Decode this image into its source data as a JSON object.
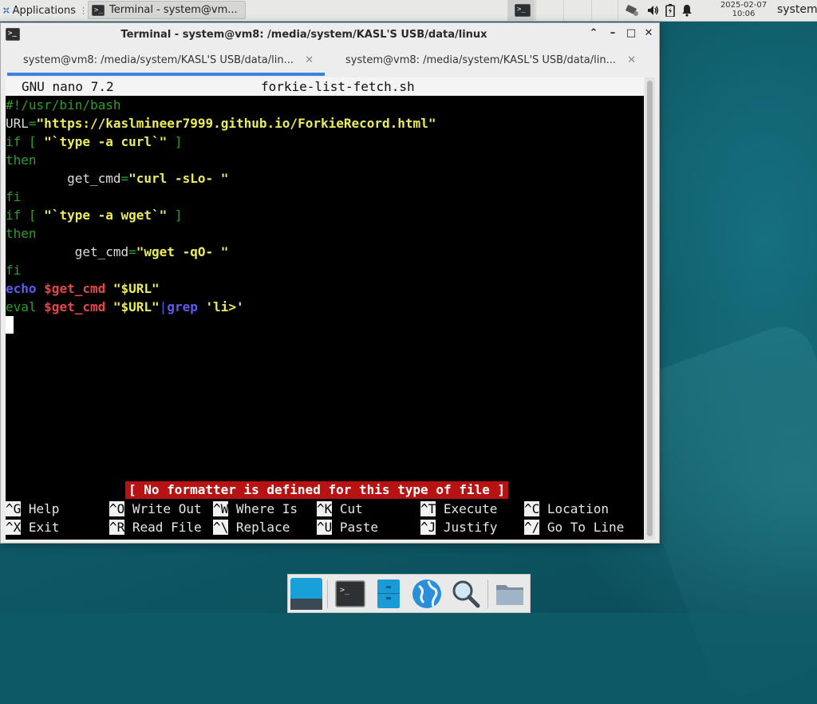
{
  "panel": {
    "apps_label": "Applications",
    "task_label": "Terminal - system@vm...",
    "clock_date": "2025-02-07",
    "clock_time": "10:06",
    "user": "system"
  },
  "window": {
    "title": "Terminal - system@vm8: /media/system/KASL'S USB/data/linux",
    "tabs": [
      {
        "label": "system@vm8: /media/system/KASL'S USB/data/lin...",
        "active": true
      },
      {
        "label": "system@vm8: /media/system/KASL'S USB/data/lin...",
        "active": false
      }
    ]
  },
  "nano": {
    "version": "GNU nano 7.2",
    "filename": "forkie-list-fetch.sh",
    "lines": [
      {
        "segments": [
          {
            "t": "#!/usr/bin/bash",
            "c": "green"
          }
        ]
      },
      {
        "segments": [
          {
            "t": "URL",
            "c": "white"
          },
          {
            "t": "=",
            "c": "green"
          },
          {
            "t": "\"https://kaslmineer7999.github.io/ForkieRecord.html\"",
            "c": "yellow"
          }
        ]
      },
      {
        "segments": [
          {
            "t": "if [ ",
            "c": "green"
          },
          {
            "t": "\"`type -a curl`\"",
            "c": "yellow"
          },
          {
            "t": " ]",
            "c": "green"
          }
        ]
      },
      {
        "segments": [
          {
            "t": "then",
            "c": "green"
          }
        ]
      },
      {
        "segments": [
          {
            "t": "        get_cmd",
            "c": "white"
          },
          {
            "t": "=",
            "c": "green"
          },
          {
            "t": "\"curl -sLo- \"",
            "c": "yellow"
          }
        ]
      },
      {
        "segments": [
          {
            "t": "fi",
            "c": "green"
          }
        ]
      },
      {
        "segments": [
          {
            "t": "if [ ",
            "c": "green"
          },
          {
            "t": "\"`type -a wget`\"",
            "c": "yellow"
          },
          {
            "t": " ]",
            "c": "green"
          }
        ]
      },
      {
        "segments": [
          {
            "t": "then",
            "c": "green"
          }
        ]
      },
      {
        "segments": [
          {
            "t": "         get_cmd",
            "c": "white"
          },
          {
            "t": "=",
            "c": "green"
          },
          {
            "t": "\"wget -qO- \"",
            "c": "yellow"
          }
        ]
      },
      {
        "segments": [
          {
            "t": "fi",
            "c": "green"
          }
        ]
      },
      {
        "segments": [
          {
            "t": "echo",
            "c": "blue"
          },
          {
            "t": " ",
            "c": "white"
          },
          {
            "t": "$get_cmd",
            "c": "red"
          },
          {
            "t": " ",
            "c": "white"
          },
          {
            "t": "\"$URL\"",
            "c": "yellow"
          }
        ]
      },
      {
        "segments": [
          {
            "t": "eval",
            "c": "green"
          },
          {
            "t": " ",
            "c": "white"
          },
          {
            "t": "$get_cmd",
            "c": "red"
          },
          {
            "t": " ",
            "c": "white"
          },
          {
            "t": "\"$URL\"",
            "c": "yellow"
          },
          {
            "t": "|",
            "c": "bar"
          },
          {
            "t": "grep",
            "c": "blue"
          },
          {
            "t": " ",
            "c": "white"
          },
          {
            "t": "'li>'",
            "c": "yellow"
          }
        ]
      }
    ],
    "status_message": "[ No formatter is defined for this type of file ]",
    "shortcuts": [
      {
        "key": "^G",
        "label": "Help"
      },
      {
        "key": "^O",
        "label": "Write Out"
      },
      {
        "key": "^W",
        "label": "Where Is"
      },
      {
        "key": "^K",
        "label": "Cut"
      },
      {
        "key": "^T",
        "label": "Execute"
      },
      {
        "key": "^C",
        "label": "Location"
      },
      {
        "key": "^X",
        "label": "Exit"
      },
      {
        "key": "^R",
        "label": "Read File"
      },
      {
        "key": "^\\",
        "label": "Replace"
      },
      {
        "key": "^U",
        "label": "Paste"
      },
      {
        "key": "^J",
        "label": "Justify"
      },
      {
        "key": "^/",
        "label": "Go To Line"
      }
    ]
  },
  "dock": {
    "items": [
      "show-desktop-icon",
      "terminal-icon",
      "file-manager-icon",
      "web-browser-icon",
      "app-finder-icon",
      "folder-icon"
    ]
  },
  "colors": {
    "green": "#2e9d2e",
    "yellow": "#ecec5a",
    "red": "#e54848",
    "blue": "#5b5bf2",
    "accent": "#3b82e0",
    "status_bg": "#b81313"
  }
}
